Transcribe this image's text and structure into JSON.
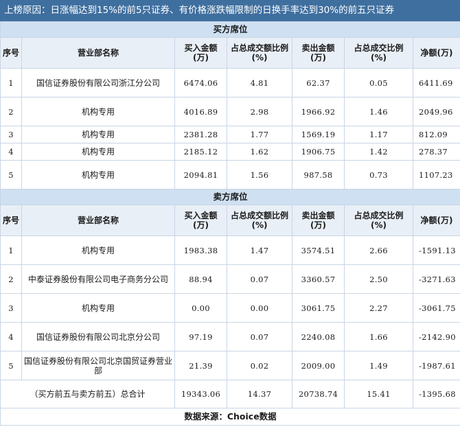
{
  "title": "上榜原因：日涨幅达到15%的前5只证券、有价格涨跌幅限制的日换手率达到30%的前五只证券",
  "headers": [
    "序号",
    "营业部名称",
    "买入金额(万)",
    "占总成交额比例(%)",
    "卖出金额(万)",
    "占总成交比例(%)",
    "净额(万)"
  ],
  "buy_section": {
    "label": "买方席位",
    "rows": [
      {
        "idx": "1",
        "name": "国信证券股份有限公司浙江分公司",
        "buy": "6474.06",
        "buy_pct": "4.81",
        "sell": "62.37",
        "sell_pct": "0.05",
        "net": "6411.69"
      },
      {
        "idx": "2",
        "name": "机构专用",
        "buy": "4016.89",
        "buy_pct": "2.98",
        "sell": "1966.92",
        "sell_pct": "1.46",
        "net": "2049.96"
      },
      {
        "idx": "3",
        "name": "机构专用",
        "buy": "2381.28",
        "buy_pct": "1.77",
        "sell": "1569.19",
        "sell_pct": "1.17",
        "net": "812.09"
      },
      {
        "idx": "4",
        "name": "机构专用",
        "buy": "2185.12",
        "buy_pct": "1.62",
        "sell": "1906.75",
        "sell_pct": "1.42",
        "net": "278.37"
      },
      {
        "idx": "5",
        "name": "机构专用",
        "buy": "2094.81",
        "buy_pct": "1.56",
        "sell": "987.58",
        "sell_pct": "0.73",
        "net": "1107.23"
      }
    ]
  },
  "sell_section": {
    "label": "卖方席位",
    "rows": [
      {
        "idx": "1",
        "name": "机构专用",
        "buy": "1983.38",
        "buy_pct": "1.47",
        "sell": "3574.51",
        "sell_pct": "2.66",
        "net": "-1591.13"
      },
      {
        "idx": "2",
        "name": "中泰证券股份有限公司电子商务分公司",
        "buy": "88.94",
        "buy_pct": "0.07",
        "sell": "3360.57",
        "sell_pct": "2.50",
        "net": "-3271.63"
      },
      {
        "idx": "3",
        "name": "机构专用",
        "buy": "0.00",
        "buy_pct": "0.00",
        "sell": "3061.75",
        "sell_pct": "2.27",
        "net": "-3061.75"
      },
      {
        "idx": "4",
        "name": "国信证券股份有限公司北京分公司",
        "buy": "97.19",
        "buy_pct": "0.07",
        "sell": "2240.08",
        "sell_pct": "1.66",
        "net": "-2142.90"
      },
      {
        "idx": "5",
        "name": "国信证券股份有限公司北京国贸证券营业部",
        "buy": "21.39",
        "buy_pct": "0.02",
        "sell": "2009.00",
        "sell_pct": "1.49",
        "net": "-1987.61"
      }
    ]
  },
  "total": {
    "label": "（买方前五与卖方前五）总合计",
    "buy": "19343.06",
    "buy_pct": "14.37",
    "sell": "20738.74",
    "sell_pct": "15.41",
    "net": "-1395.68"
  },
  "source": "数据来源：Choice数据"
}
